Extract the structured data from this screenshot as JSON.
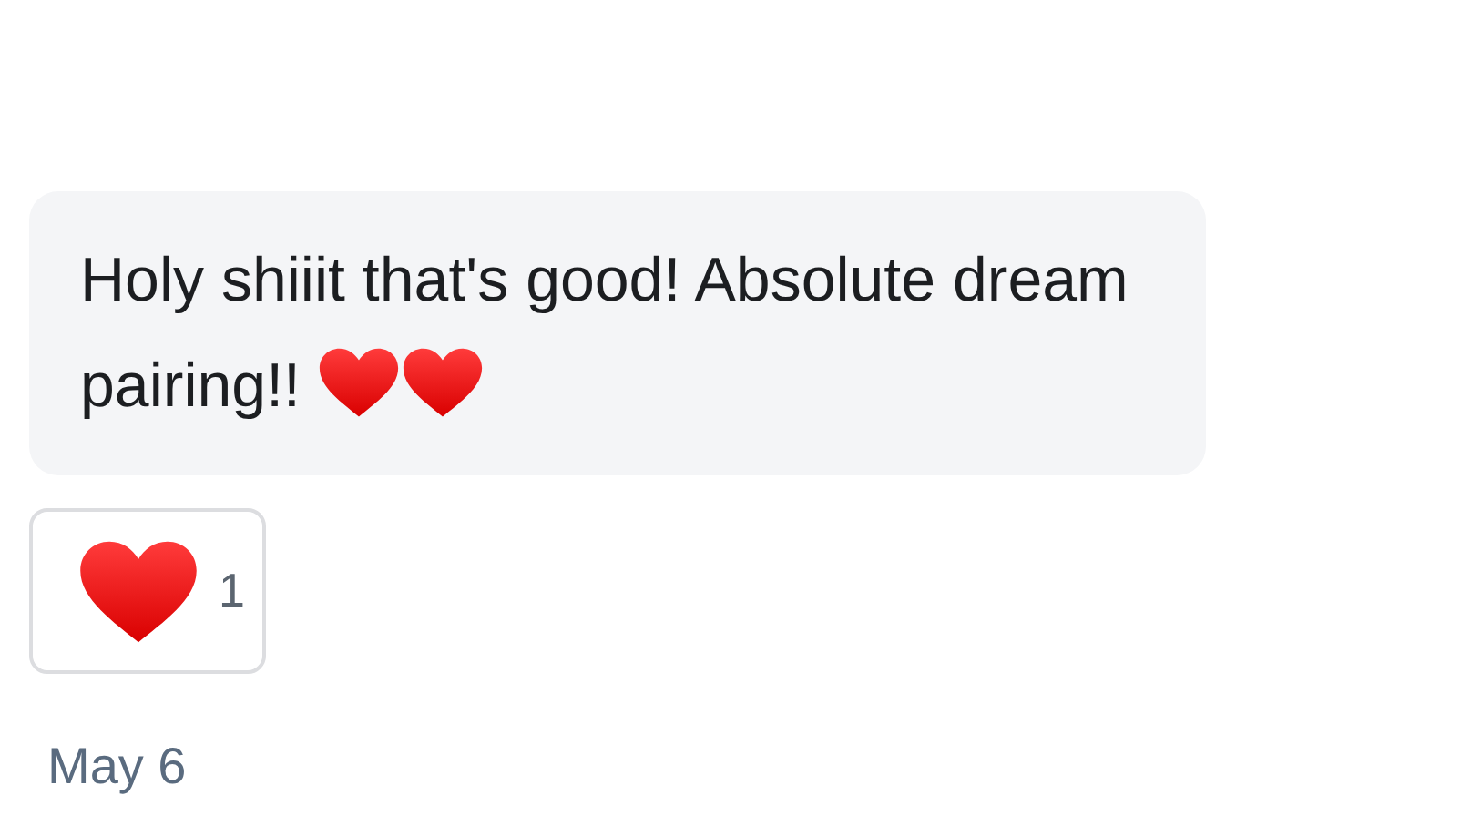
{
  "message": {
    "text": "Holy shiiit that's good! Absolute dream pairing!!",
    "emojis": [
      {
        "kind": "heart"
      },
      {
        "kind": "heart"
      }
    ]
  },
  "reactions": [
    {
      "kind": "heart",
      "count": "1"
    }
  ],
  "date": "May 6"
}
